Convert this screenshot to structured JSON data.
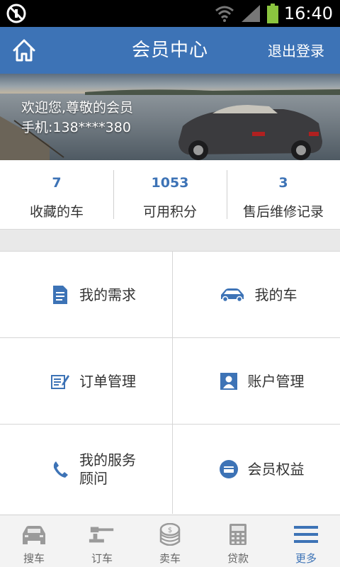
{
  "status_bar": {
    "time": "16:40"
  },
  "header": {
    "title": "会员中心",
    "logout": "退出登录"
  },
  "banner": {
    "greeting": "欢迎您,尊敬的会员",
    "phone": "手机:138****380"
  },
  "stats": [
    {
      "value": "7",
      "label": "收藏的车"
    },
    {
      "value": "1053",
      "label": "可用积分"
    },
    {
      "value": "3",
      "label": "售后维修记录"
    }
  ],
  "menu": {
    "my_demand": "我的需求",
    "my_car": "我的车",
    "order_manage": "订单管理",
    "account_manage": "账户管理",
    "service_advisor": "我的服务顾问",
    "member_benefits": "会员权益"
  },
  "tabbar": [
    {
      "label": "搜车",
      "icon": "car-icon"
    },
    {
      "label": "订车",
      "icon": "gavel-icon"
    },
    {
      "label": "卖车",
      "icon": "coins-icon"
    },
    {
      "label": "贷款",
      "icon": "calculator-icon"
    },
    {
      "label": "更多",
      "icon": "menu-icon"
    }
  ],
  "colors": {
    "accent": "#3d73b6",
    "status_bar": "#000000"
  }
}
